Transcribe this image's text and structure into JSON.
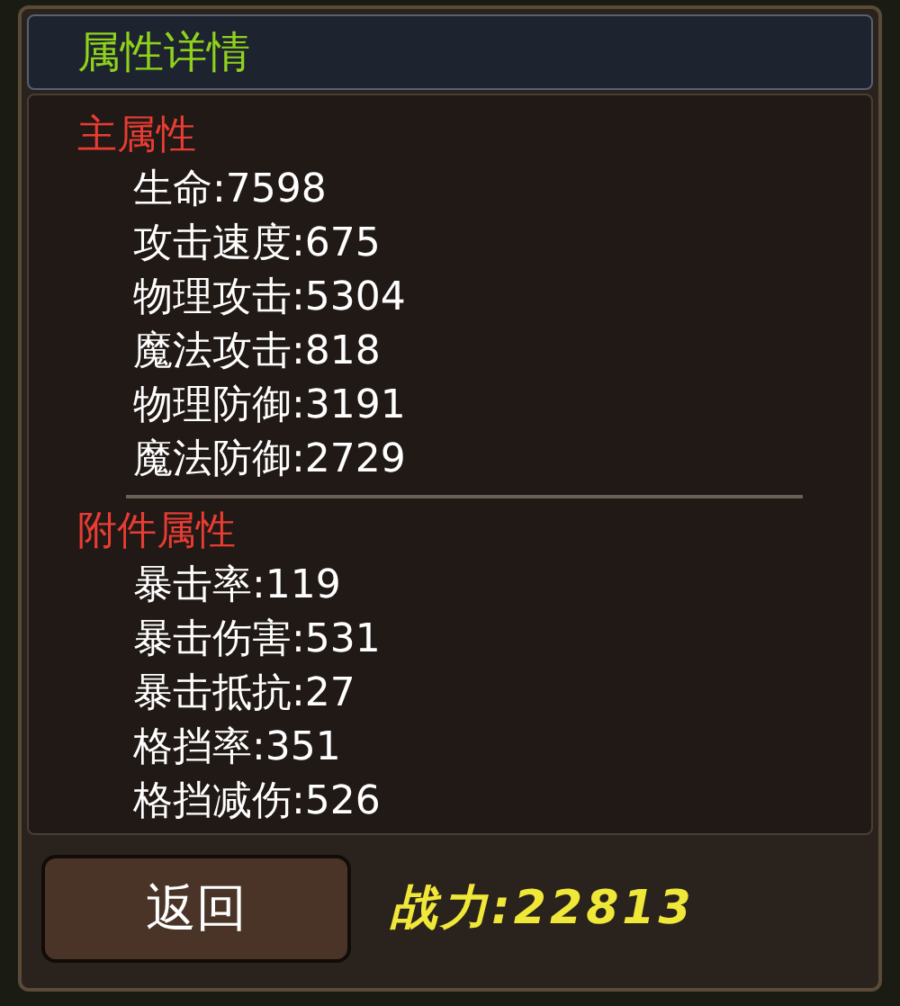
{
  "title": "属性详情",
  "sections": [
    {
      "heading": "主属性",
      "items": [
        "生命:7598",
        "攻击速度:675",
        "物理攻击:5304",
        "魔法攻击:818",
        "物理防御:3191",
        "魔法防御:2729"
      ]
    },
    {
      "heading": "附件属性",
      "items": [
        "暴击率:119",
        "暴击伤害:531",
        "暴击抵抗:27",
        "格挡率:351",
        "格挡减伤:526"
      ]
    }
  ],
  "back_button": "返回",
  "power": "战力:22813"
}
